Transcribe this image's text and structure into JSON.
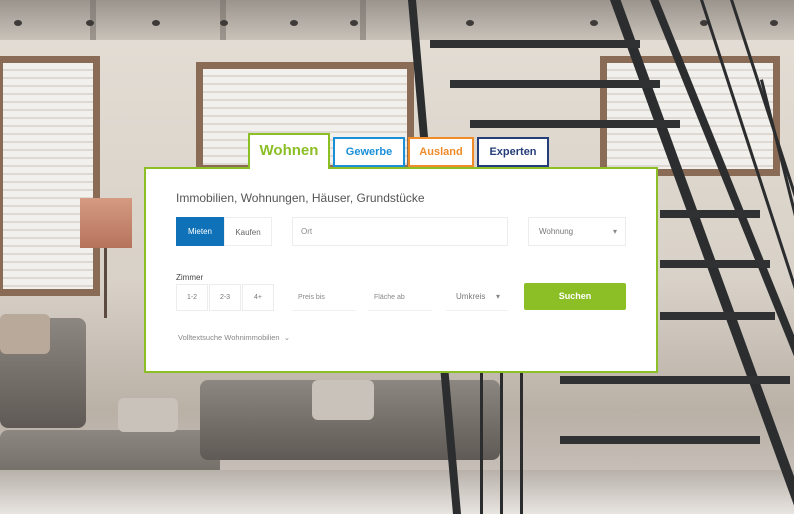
{
  "tabs": [
    {
      "label": "Wohnen",
      "color": "#8cbf26",
      "active": true
    },
    {
      "label": "Gewerbe",
      "color": "#1a8fd8",
      "active": false
    },
    {
      "label": "Ausland",
      "color": "#f08b2a",
      "active": false
    },
    {
      "label": "Experten",
      "color": "#253e7a",
      "active": false
    }
  ],
  "search": {
    "headline": "Immobilien, Wohnungen, Häuser, Grundstücke",
    "mode_rent": "Mieten",
    "mode_buy": "Kaufen",
    "location_placeholder": "Ort",
    "type_select": "Wohnung",
    "rooms_label": "Zimmer",
    "rooms": [
      "1-2",
      "2-3",
      "4+"
    ],
    "price_placeholder": "Preis bis",
    "area_placeholder": "Fläche ab",
    "radius_select": "Umkreis",
    "submit_label": "Suchen",
    "advanced_link": "Volltextsuche Wohnimmobilien"
  },
  "colors": {
    "accent": "#8cbf26",
    "primary_blue": "#0f72b9"
  }
}
